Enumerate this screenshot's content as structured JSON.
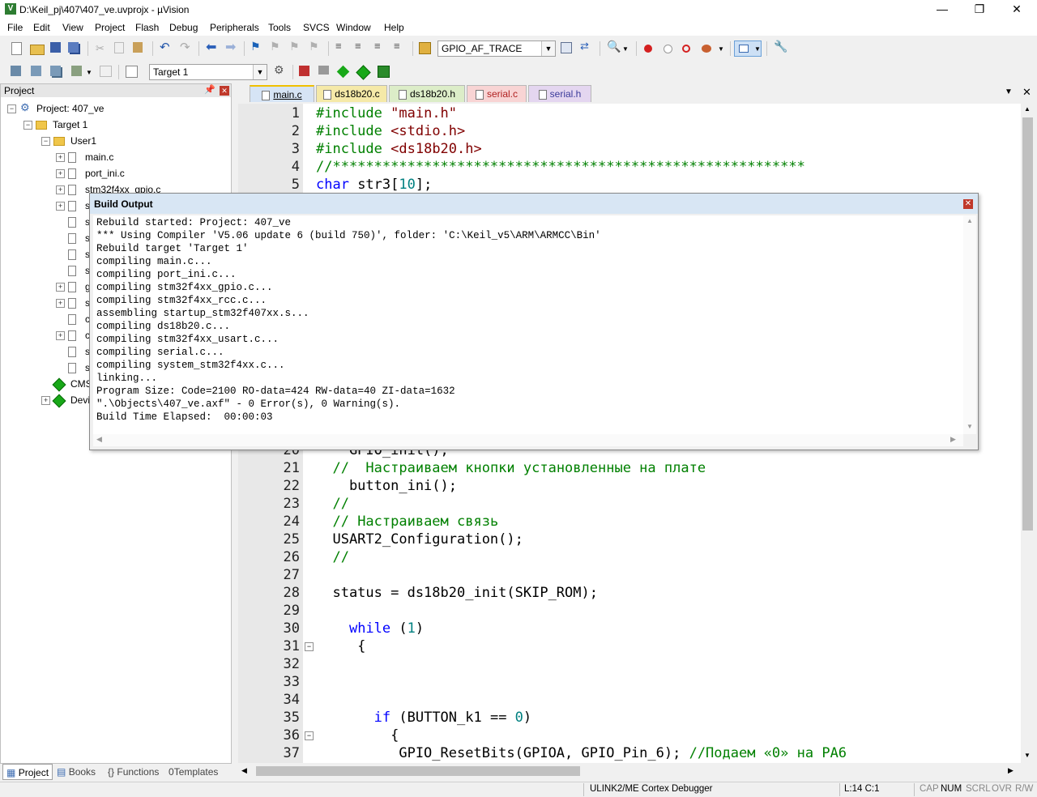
{
  "window": {
    "title": "D:\\Keil_pj\\407\\407_ve.uvprojx - µVision",
    "minimize": "—",
    "maximize": "❐",
    "close": "✕"
  },
  "menu": [
    "File",
    "Edit",
    "View",
    "Project",
    "Flash",
    "Debug",
    "Peripherals",
    "Tools",
    "SVCS",
    "Window",
    "Help"
  ],
  "toolbar1": {
    "combo_value": "GPIO_AF_TRACE"
  },
  "toolbar2": {
    "target_combo": "Target 1"
  },
  "project_panel": {
    "title": "Project",
    "tree": [
      {
        "label": "Project: 407_ve",
        "level": 0
      },
      {
        "label": "Target 1",
        "level": 1
      },
      {
        "label": "User1",
        "level": 2
      },
      {
        "label": "main.c",
        "level": 3
      },
      {
        "label": "port_ini.c",
        "level": 3
      },
      {
        "label": "stm32f4xx_gpio.c",
        "level": 3
      },
      {
        "label": "s",
        "level": 3
      },
      {
        "label": "s",
        "level": 3
      },
      {
        "label": "s",
        "level": 3
      },
      {
        "label": "s",
        "level": 3
      },
      {
        "label": "s",
        "level": 3
      },
      {
        "label": "g",
        "level": 3
      },
      {
        "label": "s",
        "level": 3
      },
      {
        "label": "c",
        "level": 3
      },
      {
        "label": "c",
        "level": 3
      },
      {
        "label": "s",
        "level": 3
      },
      {
        "label": "s",
        "level": 3
      },
      {
        "label": "CMS",
        "level": 2
      },
      {
        "label": "Devi",
        "level": 2
      }
    ],
    "bottom_tabs": [
      "Project",
      "Books",
      "Functions",
      "Templates"
    ]
  },
  "editor": {
    "tabs": [
      {
        "label": "main.c",
        "active": true,
        "color": "#d6e4f5"
      },
      {
        "label": "ds18b20.c",
        "active": false,
        "color": "#f5e9a8"
      },
      {
        "label": "ds18b20.h",
        "active": false,
        "color": "#dcedc8"
      },
      {
        "label": "serial.c",
        "active": false,
        "color": "#f8d4d4"
      },
      {
        "label": "serial.h",
        "active": false,
        "color": "#e4d6f0"
      }
    ],
    "top_lines": [
      {
        "n": "1",
        "html": "<span class='cm'>#include</span> <span class='str'>\"main.h\"</span>"
      },
      {
        "n": "2",
        "html": "<span class='cm'>#include</span> <span class='str'>&lt;stdio.h&gt;</span>"
      },
      {
        "n": "3",
        "html": "<span class='cm'>#include</span> <span class='str'>&lt;ds18b20.h&gt;</span>"
      },
      {
        "n": "4",
        "html": "<span class='cm'>//*********************************************************</span>"
      },
      {
        "n": "5",
        "html": "<span class='kw'>char</span> str3[<span class='num'>10</span>];"
      }
    ],
    "lines": [
      {
        "n": "20",
        "text": "    GPIO_init();"
      },
      {
        "n": "21",
        "text": "  //  Настраиваем кнопки установленные на плате"
      },
      {
        "n": "22",
        "text": "    button_ini();"
      },
      {
        "n": "23",
        "text": "  //"
      },
      {
        "n": "24",
        "text": "  // Настраиваем связь"
      },
      {
        "n": "25",
        "text": "  USART2_Configuration();"
      },
      {
        "n": "26",
        "text": "  //"
      },
      {
        "n": "27",
        "text": ""
      },
      {
        "n": "28",
        "text": "  status = ds18b20_init(SKIP_ROM);"
      },
      {
        "n": "29",
        "text": ""
      },
      {
        "n": "30",
        "text": "    while (1)"
      },
      {
        "n": "31",
        "text": "     {"
      },
      {
        "n": "32",
        "text": ""
      },
      {
        "n": "33",
        "text": ""
      },
      {
        "n": "34",
        "text": ""
      },
      {
        "n": "35",
        "text": "       if (BUTTON_k1 == 0)"
      },
      {
        "n": "36",
        "text": "         {"
      },
      {
        "n": "37",
        "text": "          GPIO_ResetBits(GPIOA, GPIO_Pin_6); //Подаем «0» на PA6"
      }
    ]
  },
  "build_output": {
    "title": "Build Output",
    "lines": [
      "Rebuild started: Project: 407_ve",
      "*** Using Compiler 'V5.06 update 6 (build 750)', folder: 'C:\\Keil_v5\\ARM\\ARMCC\\Bin'",
      "Rebuild target 'Target 1'",
      "compiling main.c...",
      "compiling port_ini.c...",
      "compiling stm32f4xx_gpio.c...",
      "compiling stm32f4xx_rcc.c...",
      "assembling startup_stm32f407xx.s...",
      "compiling ds18b20.c...",
      "compiling stm32f4xx_usart.c...",
      "compiling serial.c...",
      "compiling system_stm32f4xx.c...",
      "linking...",
      "Program Size: Code=2100 RO-data=424 RW-data=40 ZI-data=1632",
      "\".\\Objects\\407_ve.axf\" - 0 Error(s), 0 Warning(s).",
      "Build Time Elapsed:  00:00:03"
    ]
  },
  "status": {
    "debugger": "ULINK2/ME Cortex Debugger",
    "position": "L:14 C:1",
    "cap": "CAP",
    "num": "NUM",
    "scrl": "SCRL",
    "ovr": "OVR",
    "rw": "R/W"
  }
}
